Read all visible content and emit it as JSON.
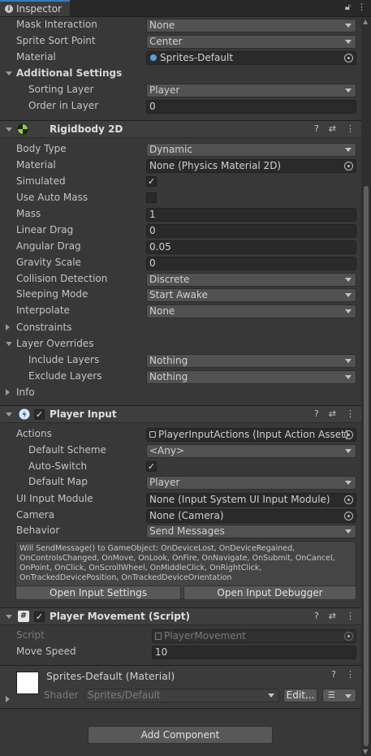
{
  "tab": {
    "title": "Inspector"
  },
  "renderer": {
    "mask_interaction": {
      "label": "Mask Interaction",
      "value": "None"
    },
    "sprite_sort_point": {
      "label": "Sprite Sort Point",
      "value": "Center"
    },
    "material": {
      "label": "Material",
      "value": "Sprites-Default"
    },
    "additional_settings": "Additional Settings",
    "sorting_layer": {
      "label": "Sorting Layer",
      "value": "Player"
    },
    "order_in_layer": {
      "label": "Order in Layer",
      "value": "0"
    }
  },
  "rigidbody": {
    "title": "Rigidbody 2D",
    "body_type": {
      "label": "Body Type",
      "value": "Dynamic"
    },
    "material": {
      "label": "Material",
      "value": "None (Physics Material 2D)"
    },
    "simulated": {
      "label": "Simulated",
      "checked": true
    },
    "use_auto_mass": {
      "label": "Use Auto Mass",
      "checked": false
    },
    "mass": {
      "label": "Mass",
      "value": "1"
    },
    "linear_drag": {
      "label": "Linear Drag",
      "value": "0"
    },
    "angular_drag": {
      "label": "Angular Drag",
      "value": "0.05"
    },
    "gravity_scale": {
      "label": "Gravity Scale",
      "value": "0"
    },
    "collision_detection": {
      "label": "Collision Detection",
      "value": "Discrete"
    },
    "sleeping_mode": {
      "label": "Sleeping Mode",
      "value": "Start Awake"
    },
    "interpolate": {
      "label": "Interpolate",
      "value": "None"
    },
    "constraints": "Constraints",
    "layer_overrides": "Layer Overrides",
    "include_layers": {
      "label": "Include Layers",
      "value": "Nothing"
    },
    "exclude_layers": {
      "label": "Exclude Layers",
      "value": "Nothing"
    },
    "info": "Info"
  },
  "player_input": {
    "title": "Player Input",
    "actions": {
      "label": "Actions",
      "value": "PlayerInputActions (Input Action Asset)"
    },
    "default_scheme": {
      "label": "Default Scheme",
      "value": "<Any>"
    },
    "auto_switch": {
      "label": "Auto-Switch",
      "checked": true
    },
    "default_map": {
      "label": "Default Map",
      "value": "Player"
    },
    "ui_input_module": {
      "label": "UI Input Module",
      "value": "None (Input System UI Input Module)"
    },
    "camera": {
      "label": "Camera",
      "value": "None (Camera)"
    },
    "behavior": {
      "label": "Behavior",
      "value": "Send Messages"
    },
    "help_text": "Will SendMessage() to GameObject: OnDeviceLost, OnDeviceRegained, OnControlsChanged, OnMove, OnLook, OnFire, OnNavigate, OnSubmit, OnCancel, OnPoint, OnClick, OnScrollWheel, OnMiddleClick, OnRightClick, OnTrackedDevicePosition, OnTrackedDeviceOrientation",
    "open_settings": "Open Input Settings",
    "open_debugger": "Open Input Debugger"
  },
  "player_movement": {
    "title": "Player Movement (Script)",
    "script": {
      "label": "Script",
      "value": "PlayerMovement"
    },
    "move_speed": {
      "label": "Move Speed",
      "value": "10"
    }
  },
  "material_preview": {
    "title": "Sprites-Default (Material)",
    "shader_label": "Shader",
    "shader_value": "Sprites/Default",
    "edit": "Edit..."
  },
  "add_component": "Add Component",
  "colors": {
    "accent": "#3a79bb",
    "background": "#383838",
    "header": "#3e3e3e"
  }
}
